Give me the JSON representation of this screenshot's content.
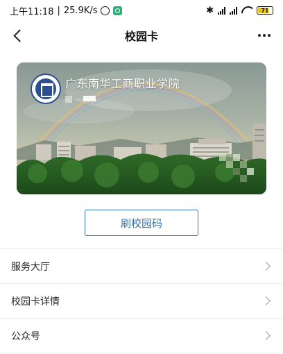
{
  "status_bar": {
    "time": "上午11:18",
    "speed": "25.9K/s",
    "battery": "71"
  },
  "header": {
    "title": "校园卡"
  },
  "card": {
    "school_name": "广东南华工商职业学院"
  },
  "actions": {
    "swipe_label": "刷校园码"
  },
  "menu": {
    "items": [
      {
        "label": "服务大厅"
      },
      {
        "label": "校园卡详情"
      },
      {
        "label": "公众号"
      }
    ]
  },
  "icons": [
    "back-arrow-icon",
    "more-dots-icon",
    "alarm-icon",
    "bluetooth-icon",
    "signal-icon",
    "wifi-icon",
    "battery-icon",
    "chevron-right-icon",
    "school-logo"
  ],
  "colors": {
    "accent": "#2f6fb3",
    "divider": "#ececec"
  }
}
